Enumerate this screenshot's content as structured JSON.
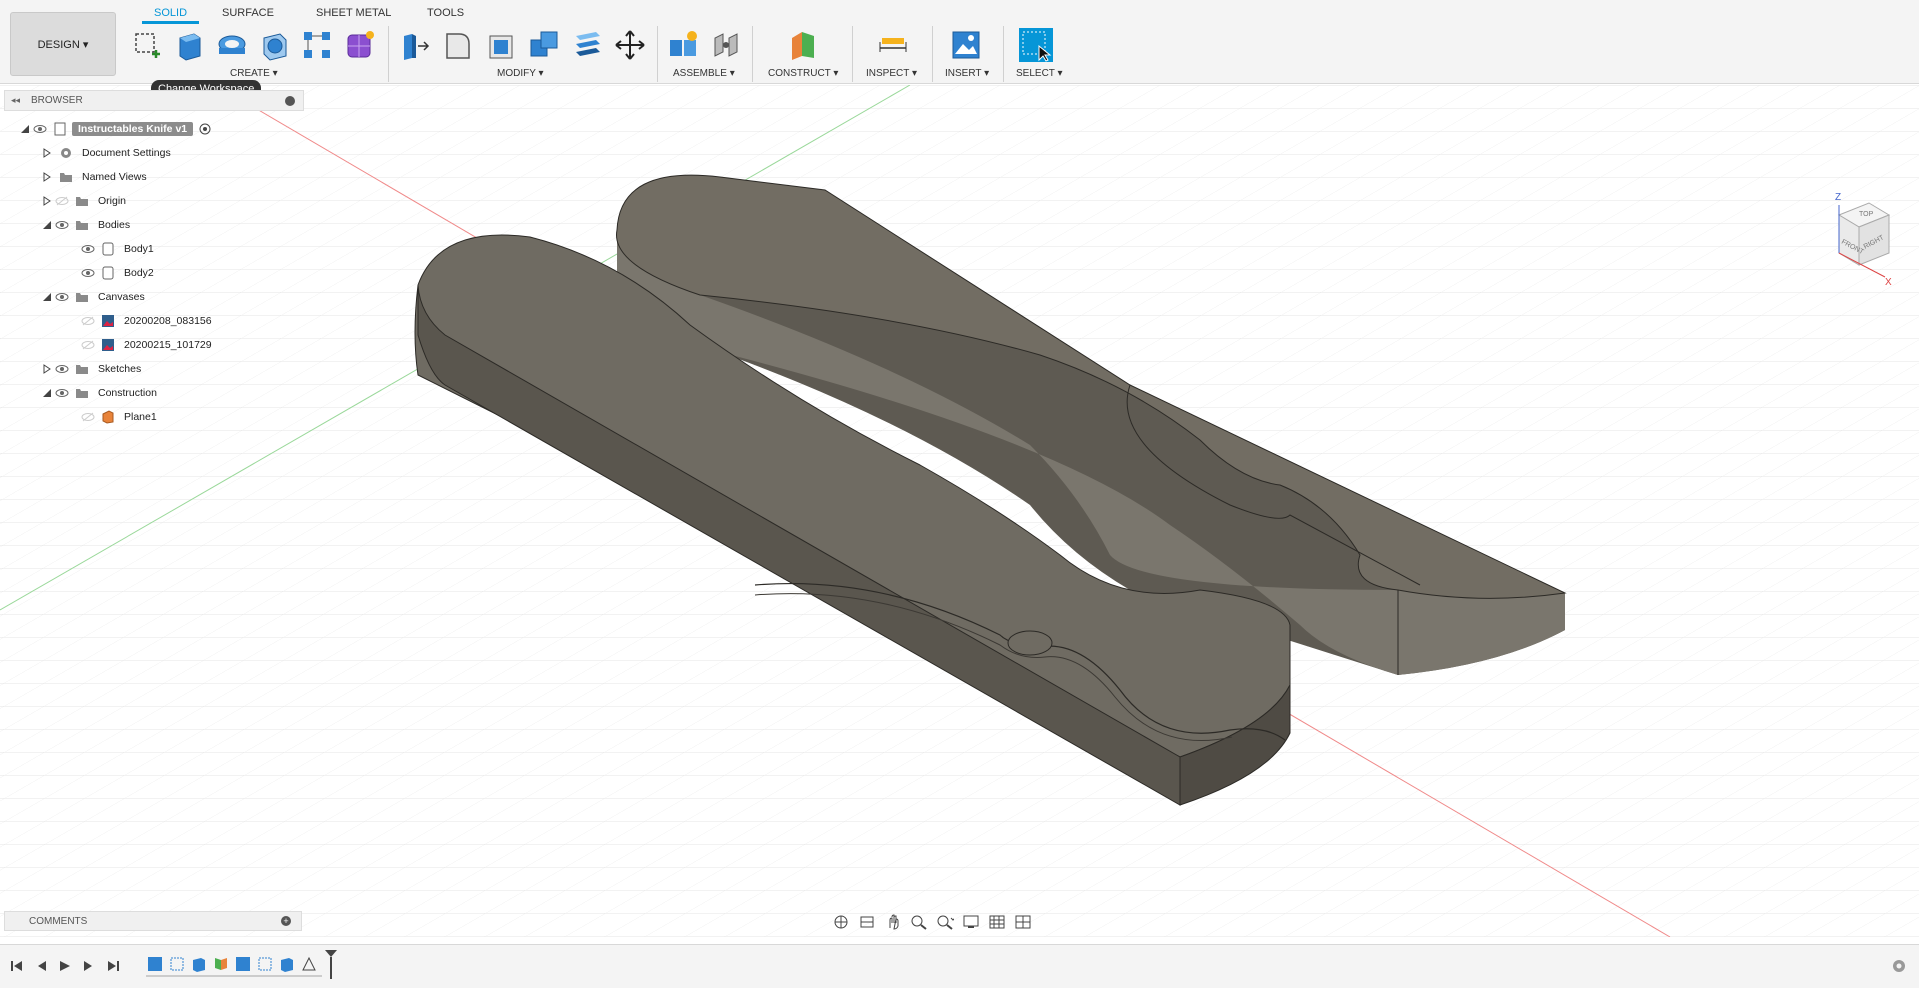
{
  "toolbar": {
    "design_label": "DESIGN ▾",
    "tabs": [
      "SOLID",
      "SURFACE",
      "SHEET METAL",
      "TOOLS"
    ],
    "groups": {
      "create": "CREATE ▾",
      "modify": "MODIFY ▾",
      "assemble": "ASSEMBLE ▾",
      "construct": "CONSTRUCT ▾",
      "inspect": "INSPECT ▾",
      "insert": "INSERT ▾",
      "select": "SELECT ▾"
    },
    "tooltip": "Change Workspace"
  },
  "browser": {
    "title": "BROWSER",
    "root": "Instructables Knife v1",
    "items": [
      {
        "label": "Document Settings"
      },
      {
        "label": "Named Views"
      },
      {
        "label": "Origin"
      },
      {
        "label": "Bodies"
      },
      {
        "label": "Body1"
      },
      {
        "label": "Body2"
      },
      {
        "label": "Canvases"
      },
      {
        "label": "20200208_083156"
      },
      {
        "label": "20200215_101729"
      },
      {
        "label": "Sketches"
      },
      {
        "label": "Construction"
      },
      {
        "label": "Plane1"
      }
    ]
  },
  "viewcube": {
    "top": "TOP",
    "front": "FRONT",
    "right": "RIGHT",
    "z": "Z",
    "x": "X"
  },
  "comments": {
    "title": "COMMENTS"
  },
  "colors": {
    "accent": "#0696d7",
    "body": "#706b60"
  }
}
